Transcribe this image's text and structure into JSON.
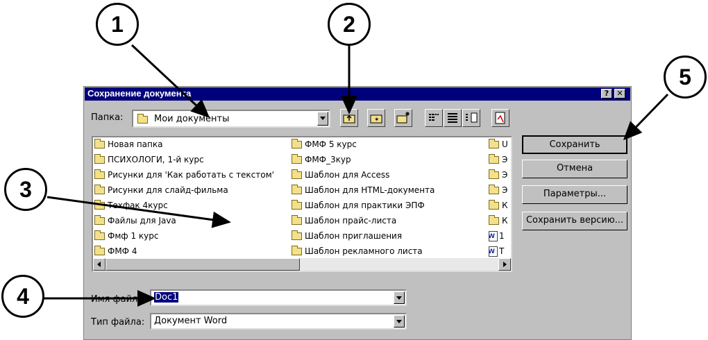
{
  "dialog": {
    "title": "Сохранение документа",
    "help_label": "?",
    "close_label": "✕"
  },
  "folder": {
    "label": "Папка:",
    "value": "Мои документы"
  },
  "toolbar": {
    "icons": [
      "up-one-level-icon",
      "search-web-icon",
      "create-folder-icon",
      "list-view-icon",
      "details-view-icon",
      "properties-view-icon",
      "commands-icon"
    ]
  },
  "files": {
    "col1": [
      "Новая папка",
      "ПСИХОЛОГИ, 1-й курс",
      "Рисунки для 'Как работать с текстом'",
      "Рисунки для слайд-фильма",
      "Техфак 4курс",
      "Файлы для Java",
      "Фмф 1 курс",
      "ФМФ 4"
    ],
    "col2": [
      "ФМФ 5 курс",
      "ФМФ_3кур",
      "Шаблон для Access",
      "Шаблон для HTML-документа",
      "Шаблон для практики ЭПФ",
      "Шаблон прайс-листа",
      "Шаблон приглашения",
      "Шаблон рекламного листа"
    ],
    "col3": [
      "U",
      "Э",
      "Э",
      "Э",
      "К",
      "К",
      "1",
      "Т"
    ]
  },
  "filename": {
    "label": "Имя файла:",
    "value": "Doc1"
  },
  "filetype": {
    "label": "Тип файла:",
    "value": "Документ Word"
  },
  "buttons": {
    "save": "Сохранить",
    "cancel": "Отмена",
    "options": "Параметры...",
    "save_version": "Сохранить версию..."
  },
  "callouts": [
    "1",
    "2",
    "3",
    "4",
    "5"
  ]
}
